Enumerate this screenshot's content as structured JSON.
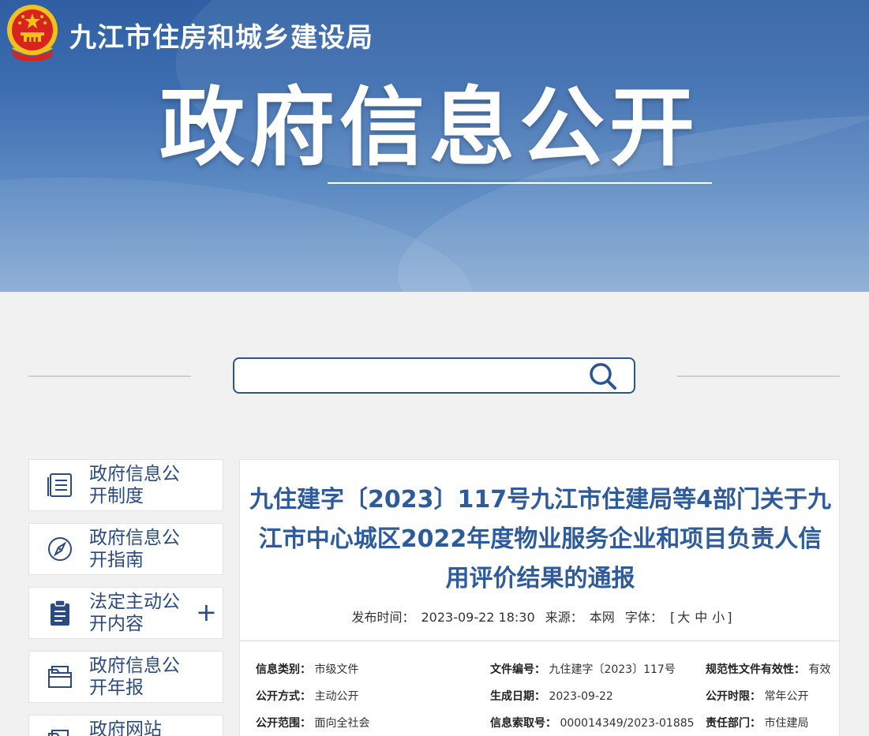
{
  "header": {
    "site_title": "九江市住房和城乡建设局",
    "banner_title": "政府信息公开"
  },
  "search": {
    "placeholder": ""
  },
  "sidebar": {
    "items": [
      {
        "label": "政府信息公开制度",
        "icon": "list-document-icon"
      },
      {
        "label": "政府信息公开指南",
        "icon": "compass-icon"
      },
      {
        "label": "法定主动公开内容",
        "icon": "clipboard-icon",
        "expand": "+"
      },
      {
        "label": "政府信息公开年报",
        "icon": "folder-icon"
      },
      {
        "label": "政府网站",
        "icon": "folder-icon"
      }
    ]
  },
  "article": {
    "title": "九住建字〔2023〕117号九江市住建局等4部门关于九江市中心城区2022年度物业服务企业和项目负责人信用评价结果的通报",
    "publish_time_label": "发布时间：",
    "publish_time": "2023-09-22 18:30",
    "source_label": "来源：",
    "source": "本网",
    "font_label": "字体：",
    "font_open": "[",
    "font_large": "大",
    "font_medium": "中",
    "font_small": "小",
    "font_close": "]"
  },
  "info_table": {
    "rows": [
      [
        {
          "key": "信息类别：",
          "value": "市级文件"
        },
        {
          "key": "文件编号：",
          "value": "九住建字〔2023〕117号"
        },
        {
          "key": "规范性文件有效性：",
          "value": "有效"
        }
      ],
      [
        {
          "key": "公开方式：",
          "value": "主动公开"
        },
        {
          "key": "生成日期：",
          "value": "2023-09-22"
        },
        {
          "key": "公开时限：",
          "value": "常年公开"
        }
      ],
      [
        {
          "key": "公开范围：",
          "value": "面向全社会"
        },
        {
          "key": "信息索取号：",
          "value": "000014349/2023-01885"
        },
        {
          "key": "责任部门：",
          "value": "市住建局"
        }
      ]
    ]
  },
  "colors": {
    "primary": "#2d5b9c",
    "banner_top": "#2f5fa2",
    "banner_bottom": "#88abd3",
    "emblem_red": "#d9231e",
    "emblem_gold": "#f3c21a"
  }
}
